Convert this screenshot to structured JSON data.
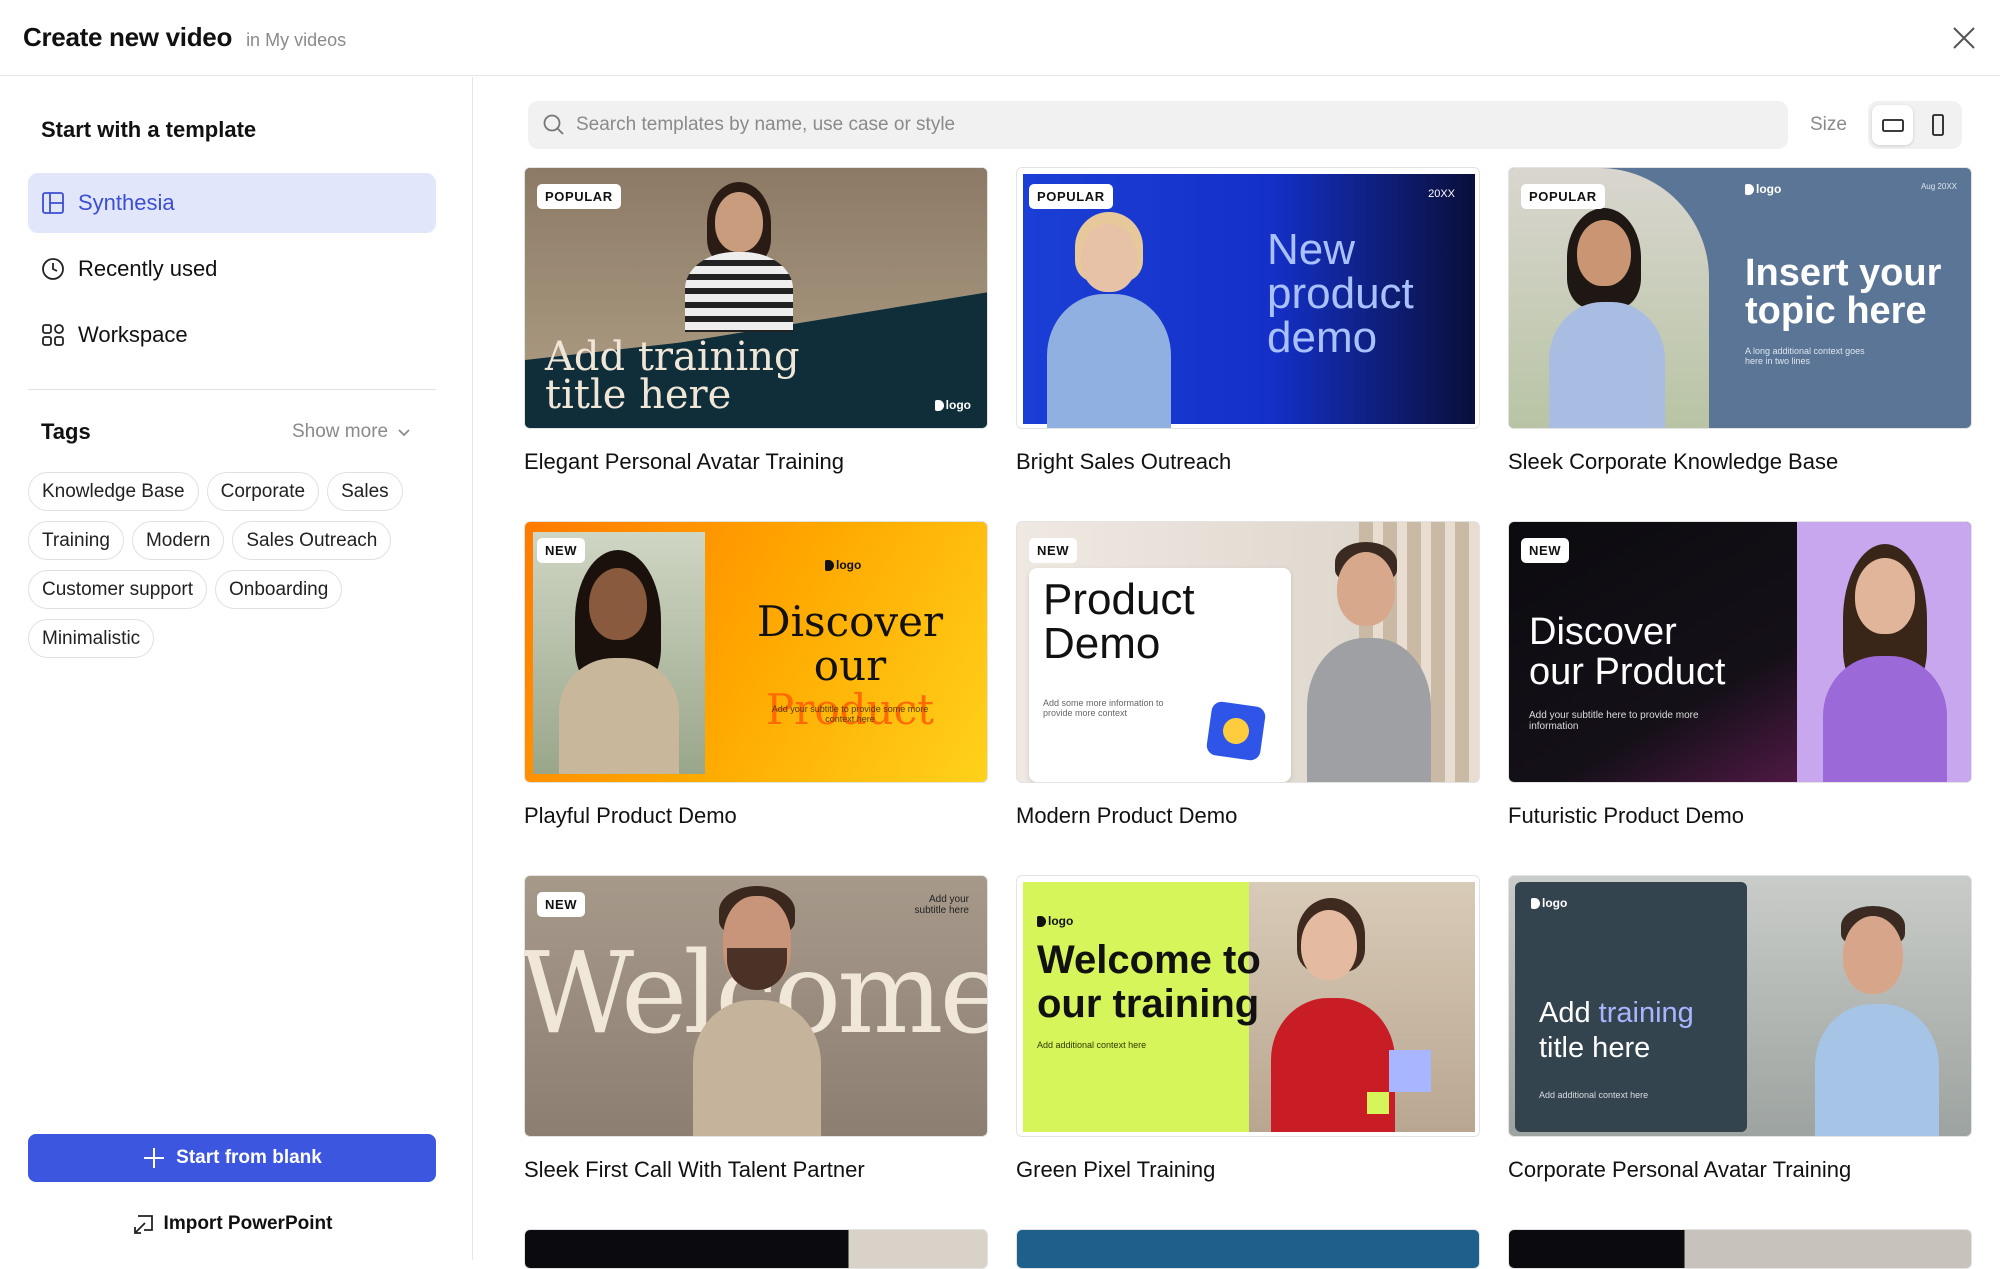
{
  "header": {
    "title": "Create new video",
    "subtitle": "in My videos"
  },
  "sidebar": {
    "heading": "Start with a template",
    "nav": [
      {
        "label": "Synthesia",
        "icon": "layout-icon",
        "active": true
      },
      {
        "label": "Recently used",
        "icon": "clock-icon",
        "active": false
      },
      {
        "label": "Workspace",
        "icon": "grid-icon",
        "active": false
      }
    ],
    "tags_heading": "Tags",
    "show_more": "Show more",
    "tags": [
      "Knowledge Base",
      "Corporate",
      "Sales",
      "Training",
      "Modern",
      "Sales Outreach",
      "Customer support",
      "Onboarding",
      "Minimalistic"
    ],
    "start_blank": "Start from blank",
    "import_ppt": "Import PowerPoint"
  },
  "search": {
    "placeholder": "Search templates by name, use case or style"
  },
  "size": {
    "label": "Size",
    "options": [
      "landscape",
      "portrait"
    ],
    "selected": "landscape"
  },
  "templates": [
    {
      "title": "Elegant Personal Avatar Training",
      "badge": "POPULAR",
      "thumb_text": [
        "Add training",
        "title here"
      ],
      "logo": "logo"
    },
    {
      "title": "Bright Sales Outreach",
      "badge": "POPULAR",
      "thumb_text": [
        "New",
        "product",
        "demo"
      ],
      "corner": "20XX"
    },
    {
      "title": "Sleek Corporate Knowledge Base",
      "badge": "POPULAR",
      "thumb_text": [
        "Insert your",
        "topic here"
      ],
      "small": "A long additional context goes here in two lines",
      "corner": "Aug 20XX",
      "logo": "logo"
    },
    {
      "title": "Playful Product Demo",
      "badge": "NEW",
      "thumb_text": [
        "Discover",
        "our",
        "Product"
      ],
      "small": "Add your subtitle to provide some more context here",
      "logo": "logo"
    },
    {
      "title": "Modern Product Demo",
      "badge": "NEW",
      "thumb_text": [
        "Product",
        "Demo"
      ],
      "small": "Add some more information to provide more context"
    },
    {
      "title": "Futuristic Product Demo",
      "badge": "NEW",
      "thumb_text": [
        "Discover",
        "our Product"
      ],
      "small": "Add your subtitle here to provide more information"
    },
    {
      "title": "Sleek First Call With Talent Partner",
      "badge": "NEW",
      "thumb_text": [
        "Welcome"
      ],
      "small": "Add your subtitle here"
    },
    {
      "title": "Green Pixel Training",
      "thumb_text": [
        "Welcome to",
        "our training"
      ],
      "small": "Add additional context here",
      "logo": "logo"
    },
    {
      "title": "Corporate Personal Avatar Training",
      "thumb_text": [
        "Add",
        "training",
        "title here"
      ],
      "small": "Add additional context here",
      "logo": "logo"
    }
  ],
  "colors": {
    "accent": "#3d56e0",
    "active_bg": "#e1e6fb",
    "active_text": "#3c4fd1"
  }
}
